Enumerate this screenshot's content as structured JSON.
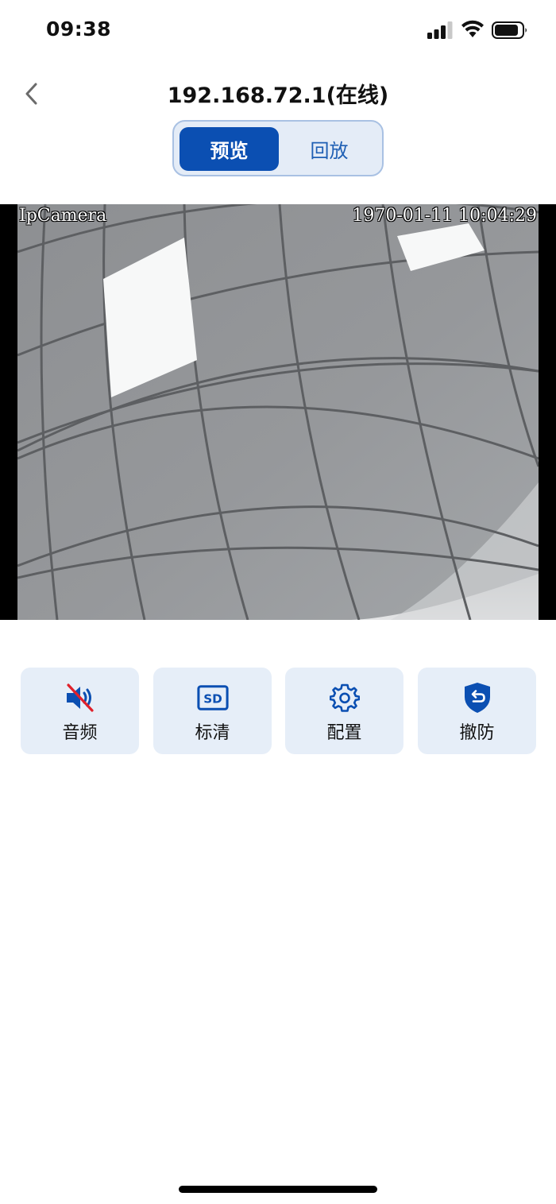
{
  "status_bar": {
    "time": "09:38",
    "icons": [
      "signal-icon",
      "wifi-icon",
      "battery-icon"
    ]
  },
  "header": {
    "back_icon": "chevron-left-icon",
    "title": "192.168.72.1(在线)"
  },
  "tabs": [
    {
      "label": "预览",
      "active": true
    },
    {
      "label": "回放",
      "active": false
    }
  ],
  "video": {
    "osd_name": "IpCamera",
    "osd_timestamp": "1970-01-11 10:04:29"
  },
  "controls": [
    {
      "label": "音频",
      "icon": "speaker-muted-icon"
    },
    {
      "label": "标清",
      "icon": "sd-quality-icon"
    },
    {
      "label": "配置",
      "icon": "gear-icon"
    },
    {
      "label": "撤防",
      "icon": "shield-disarm-icon"
    }
  ],
  "colors": {
    "accent": "#0b4fb2",
    "button_bg": "#e6eef8",
    "mute_slash": "#e0202a"
  }
}
